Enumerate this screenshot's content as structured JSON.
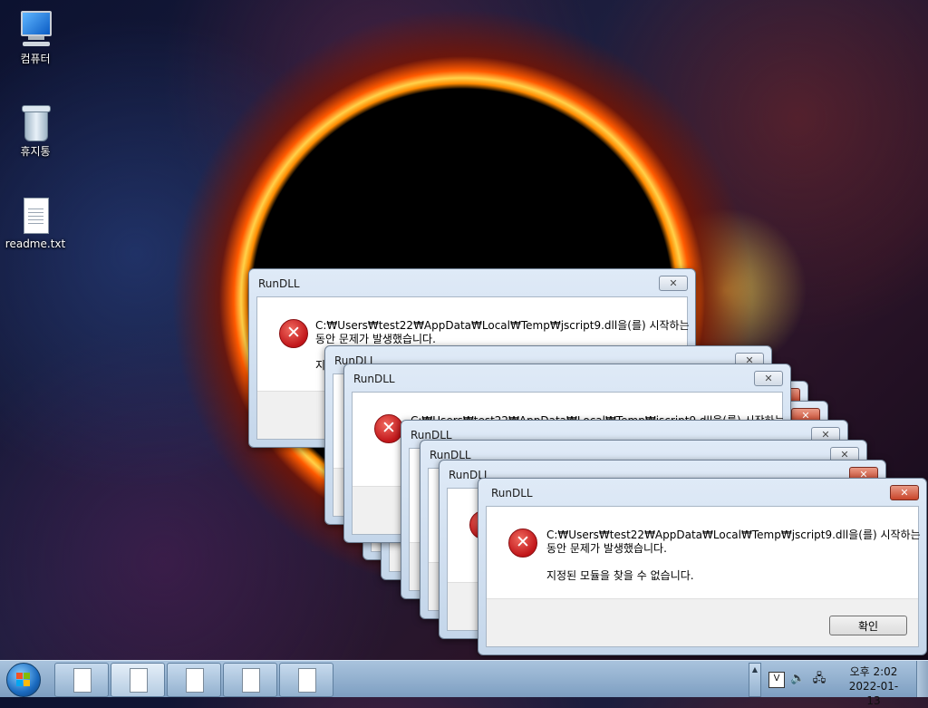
{
  "desktop": {
    "icons": [
      {
        "label": "컴퓨터",
        "icon": "computer-icon"
      },
      {
        "label": "휴지통",
        "icon": "recycle-bin-icon"
      },
      {
        "label": "readme.txt",
        "icon": "text-file-icon"
      }
    ]
  },
  "dialog": {
    "title": "RunDLL",
    "close_glyph": "✕",
    "error_glyph": "✕",
    "message_line1": "C:₩Users₩test22₩AppData₩Local₩Temp₩jscript9.dll을(를) 시작하는",
    "message_line2": "동안 문제가 발생했습니다.",
    "message_line3": "지정된 모듈을 찾을 수 없습니다.",
    "partial_line3": "지",
    "ok_label": "확인"
  },
  "taskbar": {
    "start_icon": "windows-start-icon",
    "buttons": [
      "text-file-icon",
      "text-file-icon",
      "text-file-icon",
      "text-file-icon",
      "text-file-icon"
    ],
    "tray": {
      "up_glyph": "▲",
      "icons": [
        "input-method-icon",
        "volume-icon",
        "network-icon"
      ],
      "time": "오후 2:02",
      "date": "2022-01-13"
    }
  }
}
